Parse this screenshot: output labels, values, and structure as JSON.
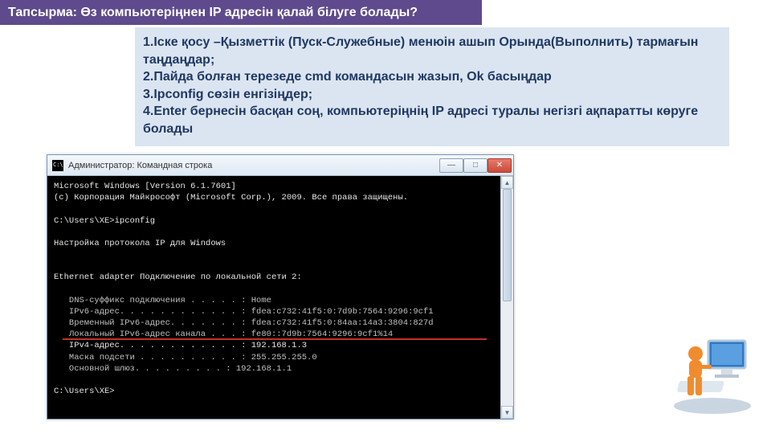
{
  "task": {
    "label": "Тапсырма: Өз компьютеріңнен IP адресін қалай білуге болады?"
  },
  "instructions": {
    "line1": "1.Іске қосу –Қызметтік (Пуск-Служебные) менюін ашып Орында(Выполнить) тармағын таңдаңдар;",
    "line2": "2.Пайда болған терезеде cmd командасын жазып, Ok басыңдар",
    "line3": "3.Ipconfig сөзін енгізіңдер;",
    "line4": "4.Enter бернесін басқан соң, компьютеріңнің IP адресі туралы негізгі ақпаратты көруге болады"
  },
  "cmd": {
    "title": "Администратор: Командная строка",
    "lines": {
      "l1": "Microsoft Windows [Version 6.1.7601]",
      "l2": "(c) Корпорация Майкрософт (Microsoft Corp.), 2009. Все права защищены.",
      "l3": "",
      "l4": "C:\\Users\\XE>ipconfig",
      "l5": "",
      "l6": "Настройка протокола IP для Windows",
      "l7": "",
      "l8": "",
      "l9": "Ethernet adapter Подключение по локальной сети 2:",
      "l10": "",
      "l11": "   DNS-суффикс подключения . . . . . : Home",
      "l12": "   IPv6-адрес. . . . . . . . . . . . : fdea:c732:41f5:0:7d9b:7564:9296:9cf1",
      "l13": "   Временный IPv6-адрес. . . . . . . : fdea:c732:41f5:0:84aa:14a3:3804:827d",
      "l14": "   Локальный IPv6-адрес канала . . . : fe80::7d9b:7564:9296:9cf1%14",
      "l15": "   IPv4-адрес. . . . . . . . . . . . : 192.168.1.3",
      "l16": "   Маска подсети . . . . . . . . . . : 255.255.255.0",
      "l17": "   Основной шлюз. . . . . . . . . : 192.168.1.1",
      "l18": "",
      "l19": "C:\\Users\\XE>"
    }
  },
  "icons": {
    "minimize": "—",
    "maximize": "□",
    "close": "✕",
    "up": "▲",
    "down": "▼"
  }
}
